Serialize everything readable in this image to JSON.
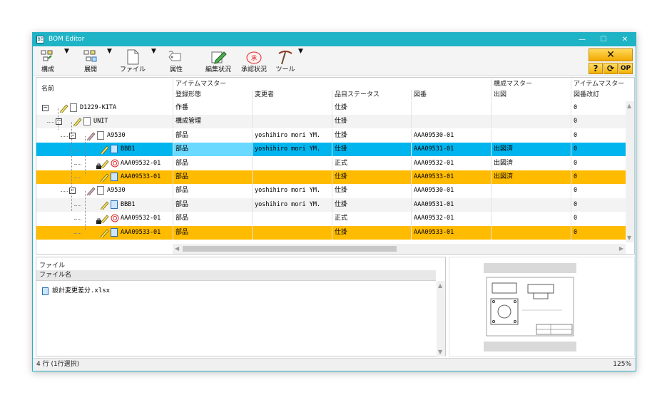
{
  "window": {
    "title": "BOM Editor",
    "controls": {
      "minimize": "—",
      "maximize": "☐",
      "close": "✕"
    }
  },
  "toolbar": {
    "items": [
      {
        "label": "構成",
        "icon": "tree-structure-icon"
      },
      {
        "label": "展開",
        "icon": "expand-tree-icon"
      },
      {
        "label": "ファイル",
        "icon": "file-icon"
      },
      {
        "label": "属性",
        "icon": "tag-icon"
      },
      {
        "label": "編集状況",
        "icon": "edit-status-icon"
      },
      {
        "label": "承認状況",
        "icon": "approval-stamp-icon"
      },
      {
        "label": "ツール",
        "icon": "pickaxe-tool-icon"
      }
    ],
    "dropdown_arrow": "▼",
    "right": {
      "close": "✕",
      "help": "?",
      "refresh": "⟳",
      "op": "OP"
    }
  },
  "grid": {
    "name_header": "名前",
    "group_headers": [
      "アイテムマスター",
      "構成マスター",
      "アイテムマスター"
    ],
    "columns": [
      "登録形態",
      "変更者",
      "品目ステータス",
      "図番",
      "出図",
      "図番改訂"
    ],
    "rows": [
      {
        "name": "D1229-KITA",
        "type": "作番",
        "changer": "",
        "status": "仕掛",
        "drawing": "",
        "issued": "",
        "rev": "0",
        "style": "normal"
      },
      {
        "name": "UNIT",
        "type": "構成管理",
        "changer": "",
        "status": "仕掛",
        "drawing": "",
        "issued": "",
        "rev": "0",
        "style": "alt"
      },
      {
        "name": "A9530",
        "type": "部品",
        "changer": "yoshihiro mori YM.",
        "status": "仕掛",
        "drawing": "AAA09530-01",
        "issued": "",
        "rev": "0",
        "style": "normal"
      },
      {
        "name": "BBB1",
        "type": "部品",
        "changer": "yoshihiro mori YM.",
        "status": "仕掛",
        "drawing": "AAA09531-01",
        "issued": "出図済",
        "rev": "0",
        "style": "sel"
      },
      {
        "name": "AAA09532-01",
        "type": "部品",
        "changer": "",
        "status": "正式",
        "drawing": "AAA09532-01",
        "issued": "出図済",
        "rev": "0",
        "style": "normal"
      },
      {
        "name": "AAA09533-01",
        "type": "部品",
        "changer": "",
        "status": "仕掛",
        "drawing": "AAA09533-01",
        "issued": "出図済",
        "rev": "0",
        "style": "hl"
      },
      {
        "name": "A9530",
        "type": "部品",
        "changer": "yoshihiro mori YM.",
        "status": "仕掛",
        "drawing": "AAA09530-01",
        "issued": "",
        "rev": "0",
        "style": "normal"
      },
      {
        "name": "BBB1",
        "type": "部品",
        "changer": "yoshihiro mori YM.",
        "status": "仕掛",
        "drawing": "AAA09531-01",
        "issued": "",
        "rev": "0",
        "style": "alt"
      },
      {
        "name": "AAA09532-01",
        "type": "部品",
        "changer": "",
        "status": "正式",
        "drawing": "AAA09532-01",
        "issued": "",
        "rev": "0",
        "style": "normal"
      },
      {
        "name": "AAA09533-01",
        "type": "部品",
        "changer": "",
        "status": "仕掛",
        "drawing": "AAA09533-01",
        "issued": "",
        "rev": "0",
        "style": "hl"
      }
    ]
  },
  "files": {
    "title": "ファイル",
    "column": "ファイル名",
    "items": [
      "設計変更差分.xlsx"
    ]
  },
  "status": {
    "left": "4 行 (1行選択)",
    "right": "125%"
  },
  "colors": {
    "titlebar": "#1fb3c6",
    "selected": "#00b4ee",
    "highlight": "#ffbb00"
  }
}
